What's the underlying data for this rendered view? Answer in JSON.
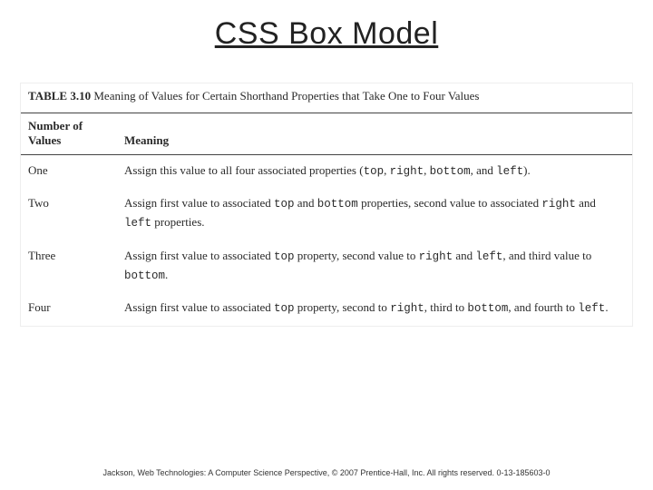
{
  "title": "CSS Box Model",
  "table": {
    "label": "TABLE 3.10",
    "caption": "Meaning of Values for Certain Shorthand Properties that Take One to Four Values",
    "head": {
      "col1a": "Number of",
      "col1b": "Values",
      "col2": "Meaning"
    },
    "rows": [
      {
        "n": "One",
        "m_a": "Assign this value to all four associated properties (",
        "k1": "top",
        "s1": ", ",
        "k2": "right",
        "s2": ", ",
        "k3": "bottom",
        "s3": ", and ",
        "k4": "left",
        "m_z": ")."
      },
      {
        "n": "Two",
        "m_a": "Assign first value to associated ",
        "k1": "top",
        "s1": " and ",
        "k2": "bottom",
        "s2": " properties, second value to associated ",
        "k3": "right",
        "s3": " and ",
        "k4": "left",
        "m_z": " properties."
      },
      {
        "n": "Three",
        "m_a": "Assign first value to associated ",
        "k1": "top",
        "s1": " property, second value to ",
        "k2": "right",
        "s2": " and ",
        "k3": "left",
        "s3": ", and third value to ",
        "k4": "bottom",
        "m_z": "."
      },
      {
        "n": "Four",
        "m_a": "Assign first value to associated ",
        "k1": "top",
        "s1": " property, second to ",
        "k2": "right",
        "s2": ", third to ",
        "k3": "bottom",
        "s3": ", and fourth to ",
        "k4": "left",
        "m_z": "."
      }
    ]
  },
  "footer": "Jackson, Web Technologies: A Computer Science Perspective, © 2007 Prentice-Hall, Inc. All rights reserved. 0-13-185603-0"
}
